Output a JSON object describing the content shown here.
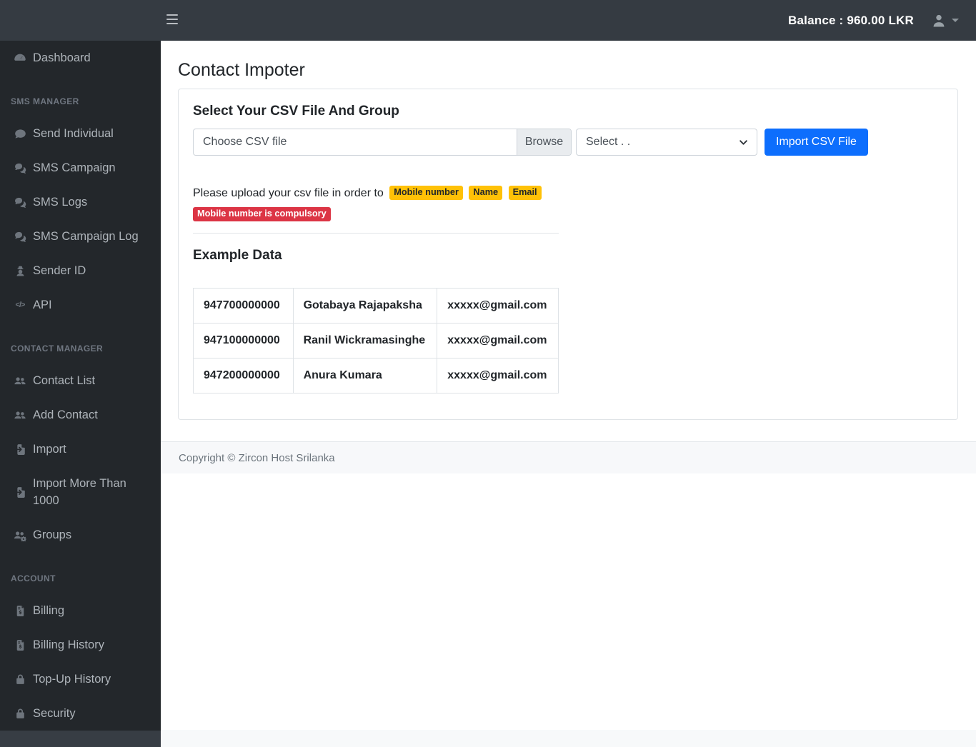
{
  "navbar": {
    "hamburger_icon": "bars-icon",
    "balance_label": "Balance : 960.00 LKR",
    "user_icon": "user-icon"
  },
  "sidebar": {
    "sections": [
      {
        "header": "",
        "items": [
          {
            "label": "Dashboard",
            "icon": "gauge-icon"
          }
        ]
      },
      {
        "header": "SMS MANAGER",
        "items": [
          {
            "label": "Send Individual",
            "icon": "comment-icon"
          },
          {
            "label": "SMS Campaign",
            "icon": "comments-icon"
          },
          {
            "label": "SMS Logs",
            "icon": "comments-icon"
          },
          {
            "label": "SMS Campaign Log",
            "icon": "comments-icon"
          },
          {
            "label": "Sender ID",
            "icon": "user-secret-icon"
          },
          {
            "label": "API",
            "icon": "code-icon"
          }
        ]
      },
      {
        "header": "CONTACT MANAGER",
        "items": [
          {
            "label": "Contact List",
            "icon": "users-icon"
          },
          {
            "label": "Add Contact",
            "icon": "users-icon"
          },
          {
            "label": "Import",
            "icon": "file-import-icon"
          },
          {
            "label": "Import More Than 1000",
            "icon": "file-import-icon"
          },
          {
            "label": "Groups",
            "icon": "users-gear-icon"
          }
        ]
      },
      {
        "header": "ACCOUNT",
        "items": [
          {
            "label": "Billing",
            "icon": "file-invoice-dollar-icon"
          },
          {
            "label": "Billing History",
            "icon": "file-invoice-dollar-icon"
          },
          {
            "label": "Top-Up History",
            "icon": "lock-icon"
          },
          {
            "label": "Security",
            "icon": "lock-icon"
          }
        ]
      }
    ]
  },
  "main": {
    "page_title": "Contact Impoter",
    "card": {
      "title": "Select Your CSV File And Group",
      "file_input_label": "Choose CSV file",
      "browse_label": "Browse",
      "group_select_value": "Select . .",
      "import_button_label": "Import CSV File",
      "hint_text": "Please upload your csv file in order to",
      "order_badges": [
        "Mobile number",
        "Name",
        "Email"
      ],
      "compulsory_badge": "Mobile number is compulsory",
      "example_title": "Example Data",
      "example_table": {
        "rows": [
          {
            "phone": "947700000000",
            "name": "Gotabaya Rajapaksha",
            "email": "xxxxx@gmail.com"
          },
          {
            "phone": "947100000000",
            "name": "Ranil Wickramasinghe",
            "email": "xxxxx@gmail.com"
          },
          {
            "phone": "947200000000",
            "name": "Anura Kumara",
            "email": "xxxxx@gmail.com"
          }
        ]
      }
    },
    "footer_text": "Copyright © Zircon Host Srilanka"
  },
  "colors": {
    "primary": "#0d6efd",
    "warning": "#ffc107",
    "danger": "#dc3545",
    "navbar_bg": "#353b42",
    "sidebar_bg": "#23272b"
  }
}
